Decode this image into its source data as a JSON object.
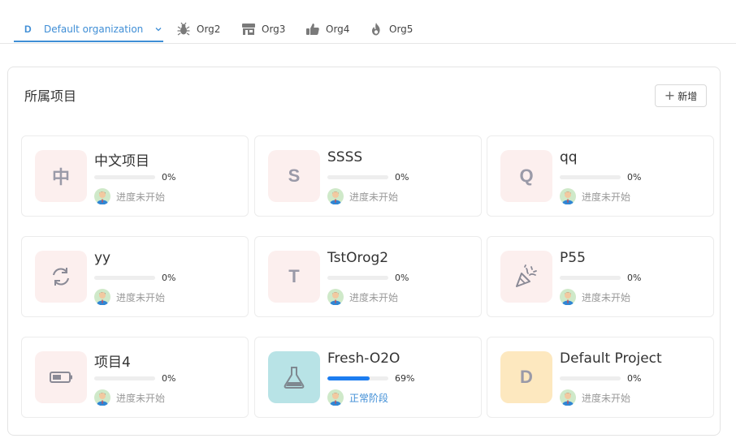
{
  "tabs": [
    {
      "letter": "D",
      "label": "Default organization",
      "icon": "letter-badge",
      "active": true
    },
    {
      "label": "Org2",
      "icon": "bug-icon"
    },
    {
      "label": "Org3",
      "icon": "store-icon"
    },
    {
      "label": "Org4",
      "icon": "thumbs-up-icon"
    },
    {
      "label": "Org5",
      "icon": "fire-icon"
    }
  ],
  "panel": {
    "title": "所属项目",
    "add_label": "新增",
    "add_icon": "plus-icon"
  },
  "colors": {
    "accent": "#3f8ed6",
    "progress": "#1c7df0",
    "thumb_pink": "#fcefee",
    "thumb_teal": "#b8e3e6",
    "thumb_yellow": "#fde8bf"
  },
  "projects": [
    {
      "name": "中文项目",
      "thumb_text": "中",
      "thumb_icon": "",
      "thumb_color": "#fcefee",
      "progress": 0,
      "pct": "0%",
      "status": "进度未开始"
    },
    {
      "name": "SSSS",
      "thumb_text": "S",
      "thumb_icon": "",
      "thumb_color": "#fcefee",
      "progress": 0,
      "pct": "0%",
      "status": "进度未开始"
    },
    {
      "name": "qq",
      "thumb_text": "Q",
      "thumb_icon": "",
      "thumb_color": "#fcefee",
      "progress": 0,
      "pct": "0%",
      "status": "进度未开始"
    },
    {
      "name": "yy",
      "thumb_text": "",
      "thumb_icon": "refresh-icon",
      "thumb_color": "#fcefee",
      "progress": 0,
      "pct": "0%",
      "status": "进度未开始"
    },
    {
      "name": "TstOrog2",
      "thumb_text": "T",
      "thumb_icon": "",
      "thumb_color": "#fcefee",
      "progress": 0,
      "pct": "0%",
      "status": "进度未开始"
    },
    {
      "name": "P55",
      "thumb_text": "",
      "thumb_icon": "party-popper-icon",
      "thumb_color": "#fcefee",
      "progress": 0,
      "pct": "0%",
      "status": "进度未开始"
    },
    {
      "name": "项目4",
      "thumb_text": "",
      "thumb_icon": "battery-icon",
      "thumb_color": "#fcefee",
      "progress": 0,
      "pct": "0%",
      "status": "进度未开始"
    },
    {
      "name": "Fresh-O2O",
      "thumb_text": "",
      "thumb_icon": "flask-icon",
      "thumb_color": "#b8e3e6",
      "progress": 0.69,
      "pct": "69%",
      "status": "正常阶段",
      "status_active": true
    },
    {
      "name": "Default Project",
      "thumb_text": "D",
      "thumb_icon": "",
      "thumb_color": "#fde8bf",
      "progress": 0,
      "pct": "0%",
      "status": "进度未开始"
    }
  ]
}
